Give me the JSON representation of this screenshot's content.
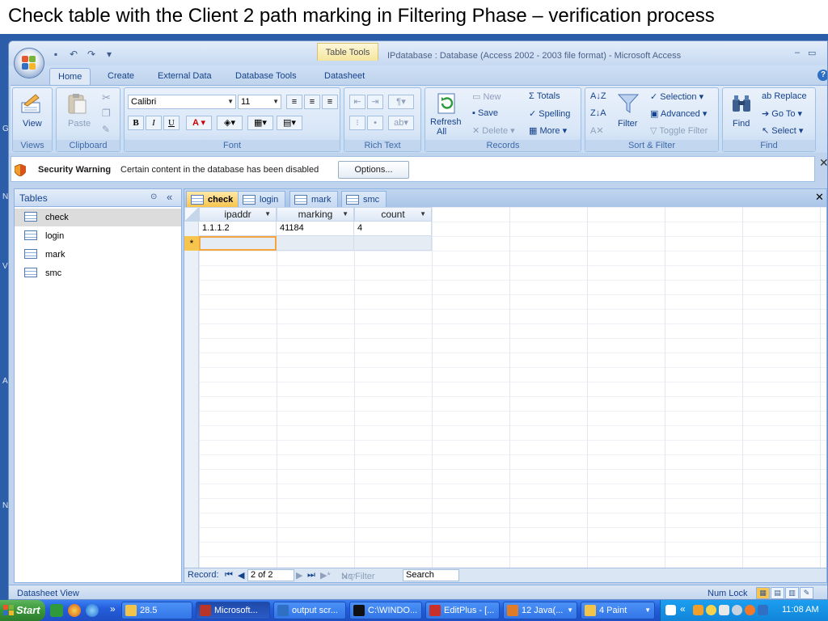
{
  "slide_title": "Check table with the Client 2 path marking in Filtering Phase – verification process",
  "desktop_letters": [
    "G",
    "N",
    "V",
    "A",
    "N"
  ],
  "window": {
    "title": "IPdatabase : Database (Access 2002 - 2003 file format) - Microsoft Access",
    "contextual_tab": "Table Tools",
    "controls": [
      "–",
      "▭"
    ]
  },
  "qat": [
    "save-icon",
    "undo-icon",
    "redo-icon",
    "customize-icon"
  ],
  "ribbon_tabs": [
    "Home",
    "Create",
    "External Data",
    "Database Tools",
    "Datasheet"
  ],
  "ribbon": {
    "views": {
      "label": "Views",
      "view": "View"
    },
    "clipboard": {
      "label": "Clipboard",
      "paste": "Paste"
    },
    "font": {
      "label": "Font",
      "family": "Calibri",
      "size": "11",
      "bold": "B",
      "italic": "I",
      "underline": "U",
      "font_color": "A"
    },
    "rich_text": {
      "label": "Rich Text"
    },
    "records": {
      "label": "Records",
      "refresh": "Refresh",
      "refresh2": "All",
      "new": "New",
      "save": "Save",
      "delete": "Delete",
      "totals": "Totals",
      "spelling": "Spelling",
      "more": "More"
    },
    "sort_filter": {
      "label": "Sort & Filter",
      "filter": "Filter",
      "selection": "Selection",
      "advanced": "Advanced",
      "toggle": "Toggle Filter"
    },
    "find": {
      "label": "Find",
      "find": "Find",
      "replace": "Replace",
      "goto": "Go To",
      "select": "Select"
    }
  },
  "security": {
    "title": "Security Warning",
    "message": "Certain content in the database has been disabled",
    "options": "Options..."
  },
  "nav": {
    "title": "Tables",
    "items": [
      "check",
      "login",
      "mark",
      "smc"
    ],
    "selected": "check"
  },
  "doc_tabs": [
    "check",
    "login",
    "mark",
    "smc"
  ],
  "datasheet": {
    "columns": [
      "ipaddr",
      "marking",
      "count"
    ],
    "rows": [
      [
        "1.1.1.2",
        "41184",
        "4"
      ]
    ],
    "new_row_marker": "*"
  },
  "record_nav": {
    "label": "Record:",
    "position": "2 of 2",
    "filter": "No Filter",
    "search": "Search"
  },
  "status": {
    "left": "Datasheet View",
    "num_lock": "Num Lock"
  },
  "taskbar": {
    "start": "Start",
    "tasks": [
      "28.5",
      "Microsoft...",
      "output scr...",
      "C:\\WINDO...",
      "EditPlus - [...",
      "12 Java(...",
      "4 Paint"
    ],
    "active_task": "Microsoft...",
    "clock": "11:08 AM"
  }
}
